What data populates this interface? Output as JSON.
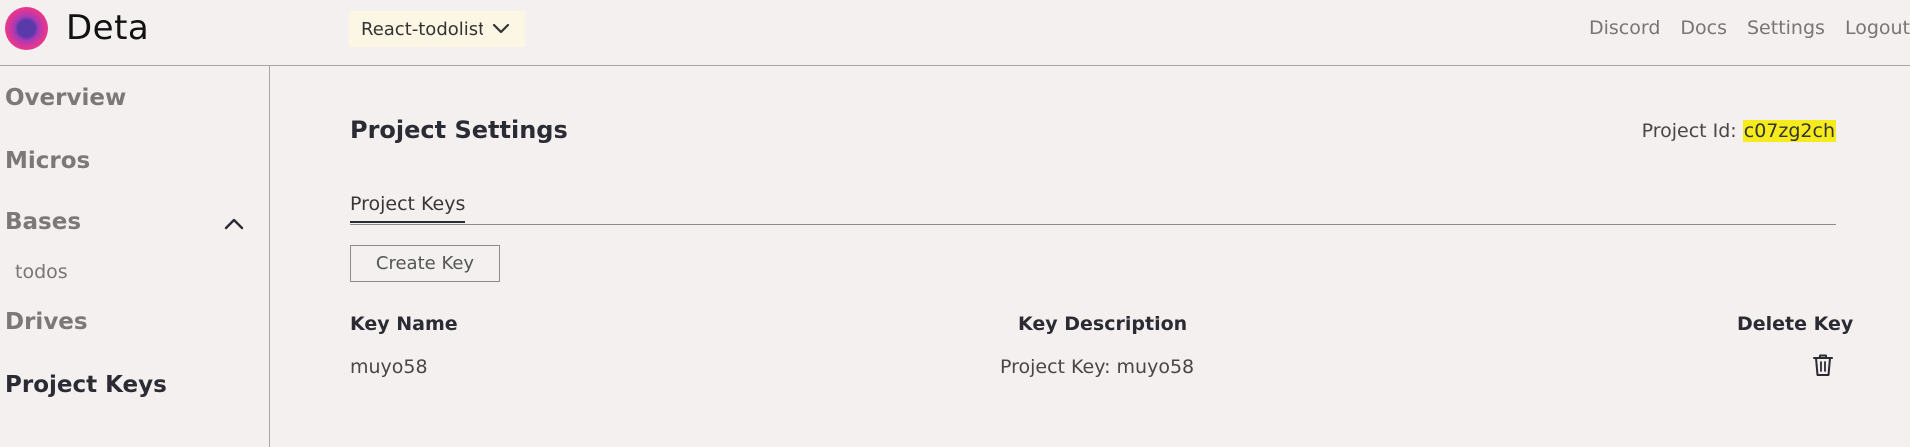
{
  "header": {
    "brand": "Deta",
    "project_select": "React-todolist",
    "nav": [
      "Discord",
      "Docs",
      "Settings",
      "Logout"
    ]
  },
  "sidebar": {
    "items": [
      "Overview",
      "Micros",
      "Bases",
      "Drives",
      "Project Keys"
    ],
    "bases_children": [
      "todos"
    ],
    "active": "Project Keys"
  },
  "main": {
    "title": "Project Settings",
    "project_id_label": "Project Id:",
    "project_id_value": "c07zg2ch",
    "tab_label": "Project Keys",
    "create_button": "Create Key",
    "columns": [
      "Key Name",
      "Key Description",
      "Delete Key"
    ],
    "rows": [
      {
        "name": "muyo58",
        "description": "Project Key: muyo58",
        "delete_icon": "trash-icon"
      }
    ]
  },
  "colors": {
    "background": "#f4f0f0",
    "highlight": "#f6ec1d",
    "project_select_bg": "#fcf6e4"
  }
}
